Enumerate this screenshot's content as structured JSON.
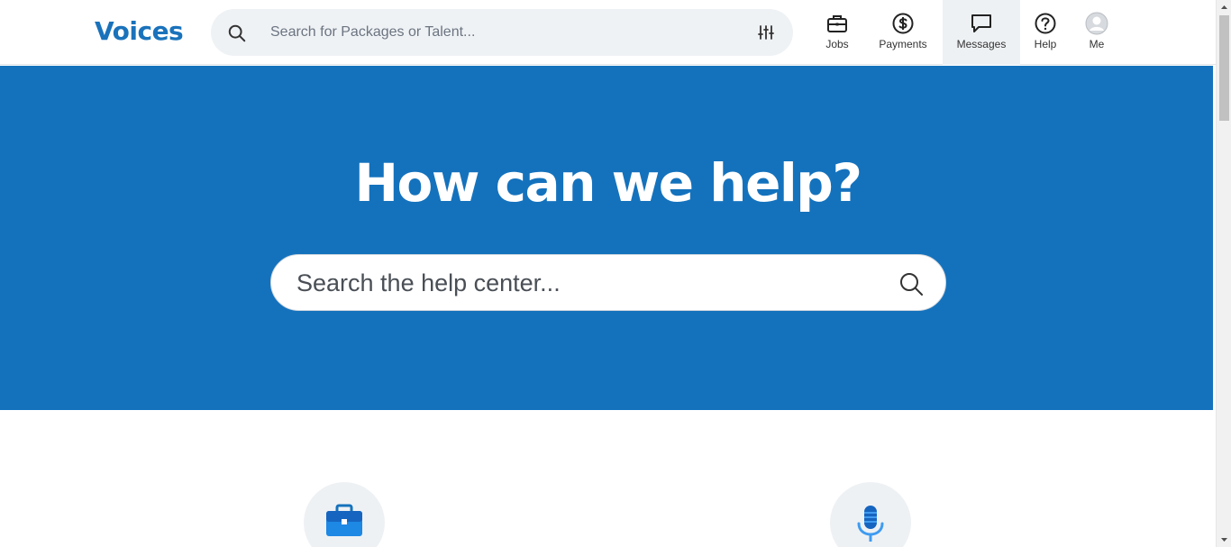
{
  "header": {
    "logo": "Voices",
    "search_placeholder": "Search for Packages or Talent...",
    "nav": [
      {
        "label": "Jobs",
        "icon": "briefcase-icon"
      },
      {
        "label": "Payments",
        "icon": "dollar-circle-icon"
      },
      {
        "label": "Messages",
        "icon": "chat-bubble-icon",
        "active": true
      },
      {
        "label": "Help",
        "icon": "question-circle-icon"
      },
      {
        "label": "Me",
        "icon": "avatar-icon"
      }
    ]
  },
  "hero": {
    "title": "How can we help?",
    "search_placeholder": "Search the help center..."
  },
  "categories": [
    {
      "icon": "briefcase-icon"
    },
    {
      "icon": "microphone-icon"
    }
  ],
  "colors": {
    "brand": "#1a72bb",
    "hero_bg": "#1472bd",
    "nav_active_bg": "#eef1f4"
  }
}
